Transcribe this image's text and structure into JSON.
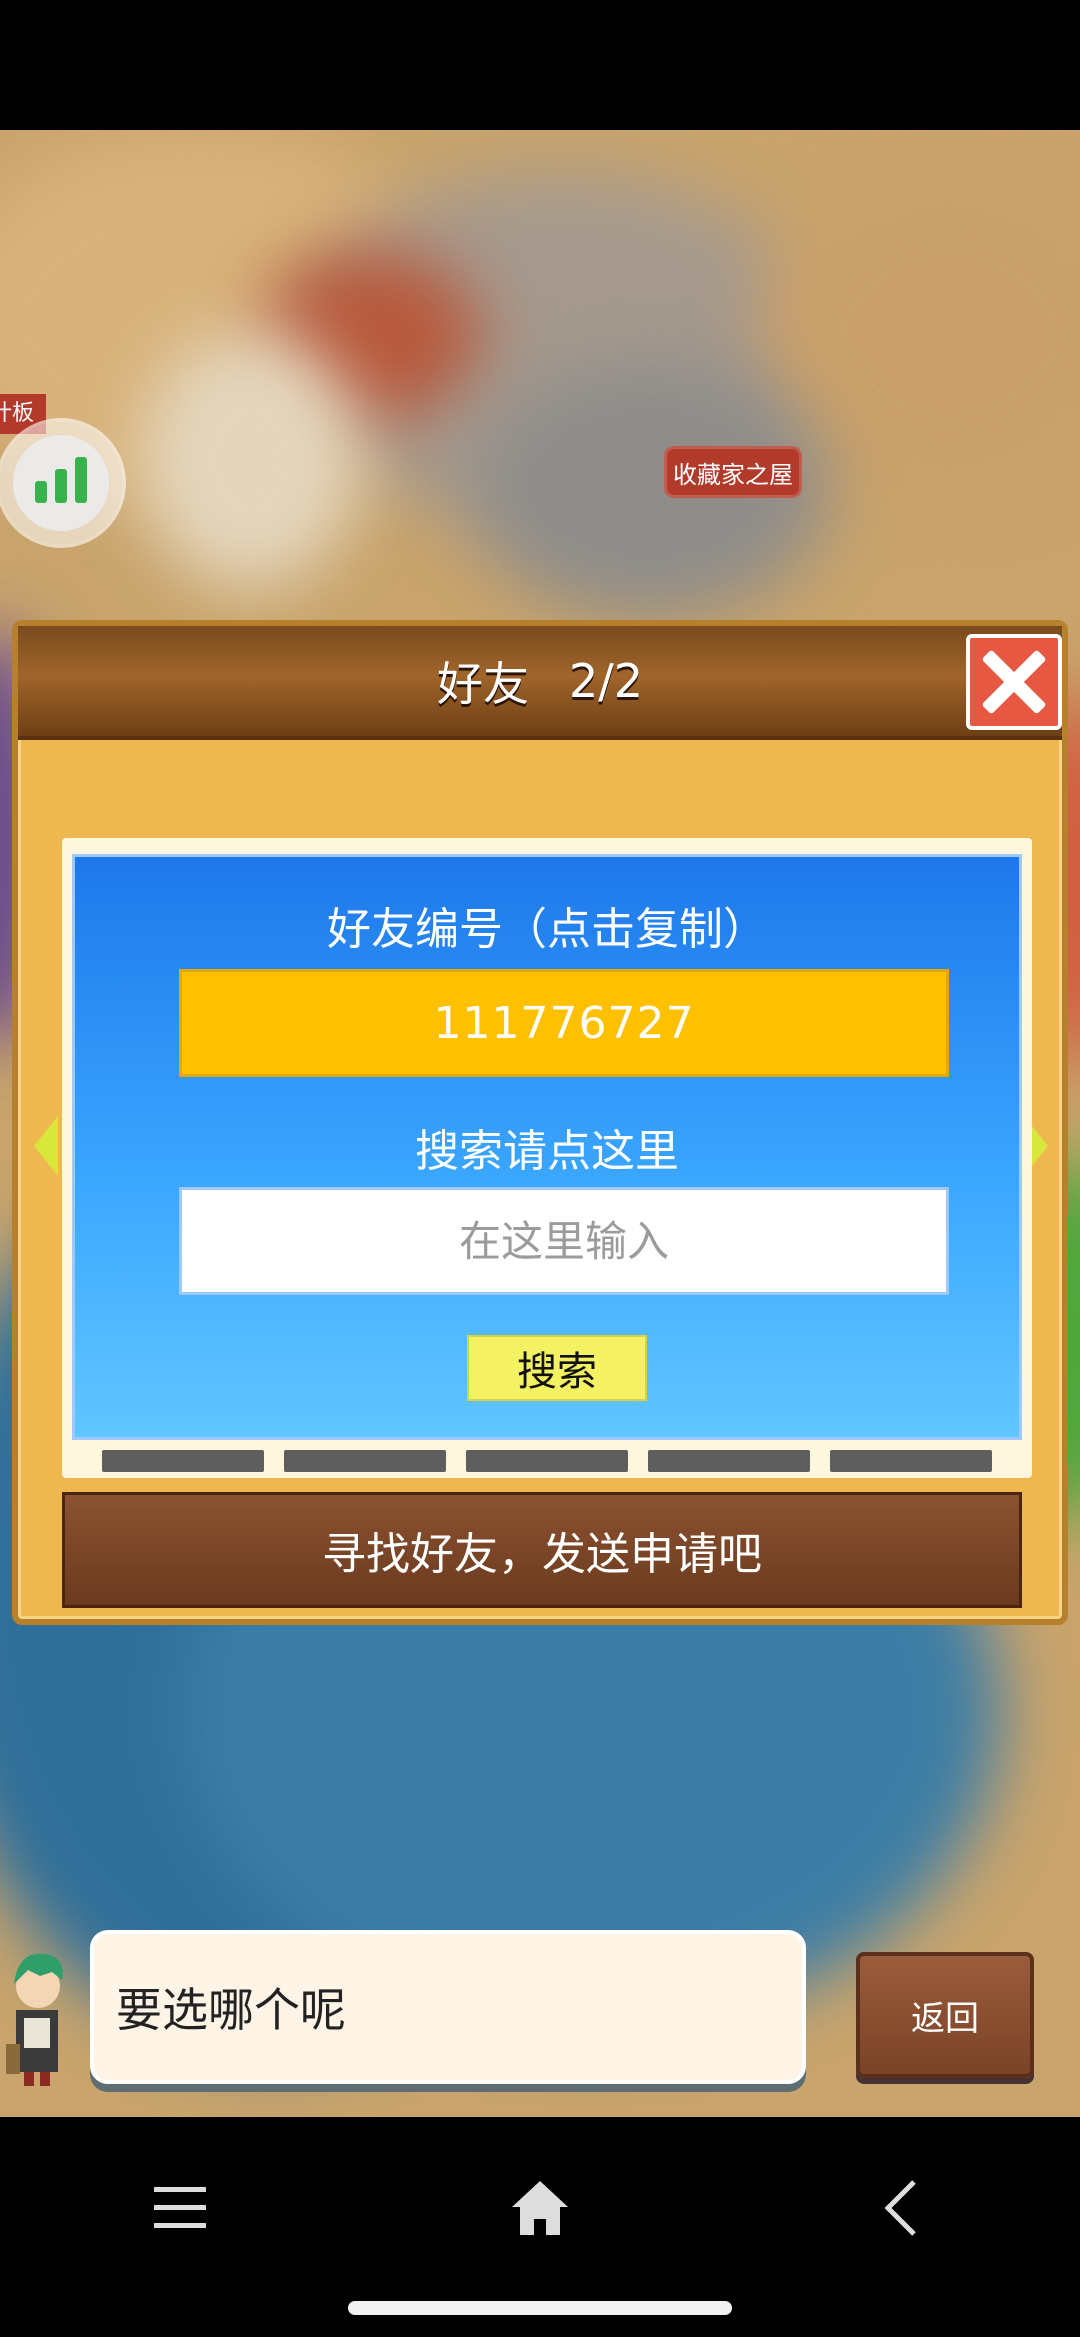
{
  "game_map": {
    "building_label": "收藏家之屋",
    "left_tag": "计板"
  },
  "friends_panel": {
    "title": "好友",
    "page": "2/2",
    "card": {
      "friend_id_label": "好友编号（点击复制）",
      "friend_id_value": "111776727",
      "search_label": "搜索请点这里",
      "search_placeholder": "在这里输入",
      "search_button": "搜索"
    },
    "banner": "寻找好友，发送申请吧"
  },
  "dialog": {
    "speech": "要选哪个呢",
    "back_button": "返回"
  },
  "colors": {
    "card_top": "#1e78ea",
    "id_box": "#ffc000",
    "search_button": "#f4f163",
    "close_button": "#e65842"
  },
  "icons": [
    "stats-icon",
    "close-icon",
    "arrow-left-icon",
    "arrow-right-icon",
    "menu-icon",
    "home-icon",
    "back-icon"
  ]
}
